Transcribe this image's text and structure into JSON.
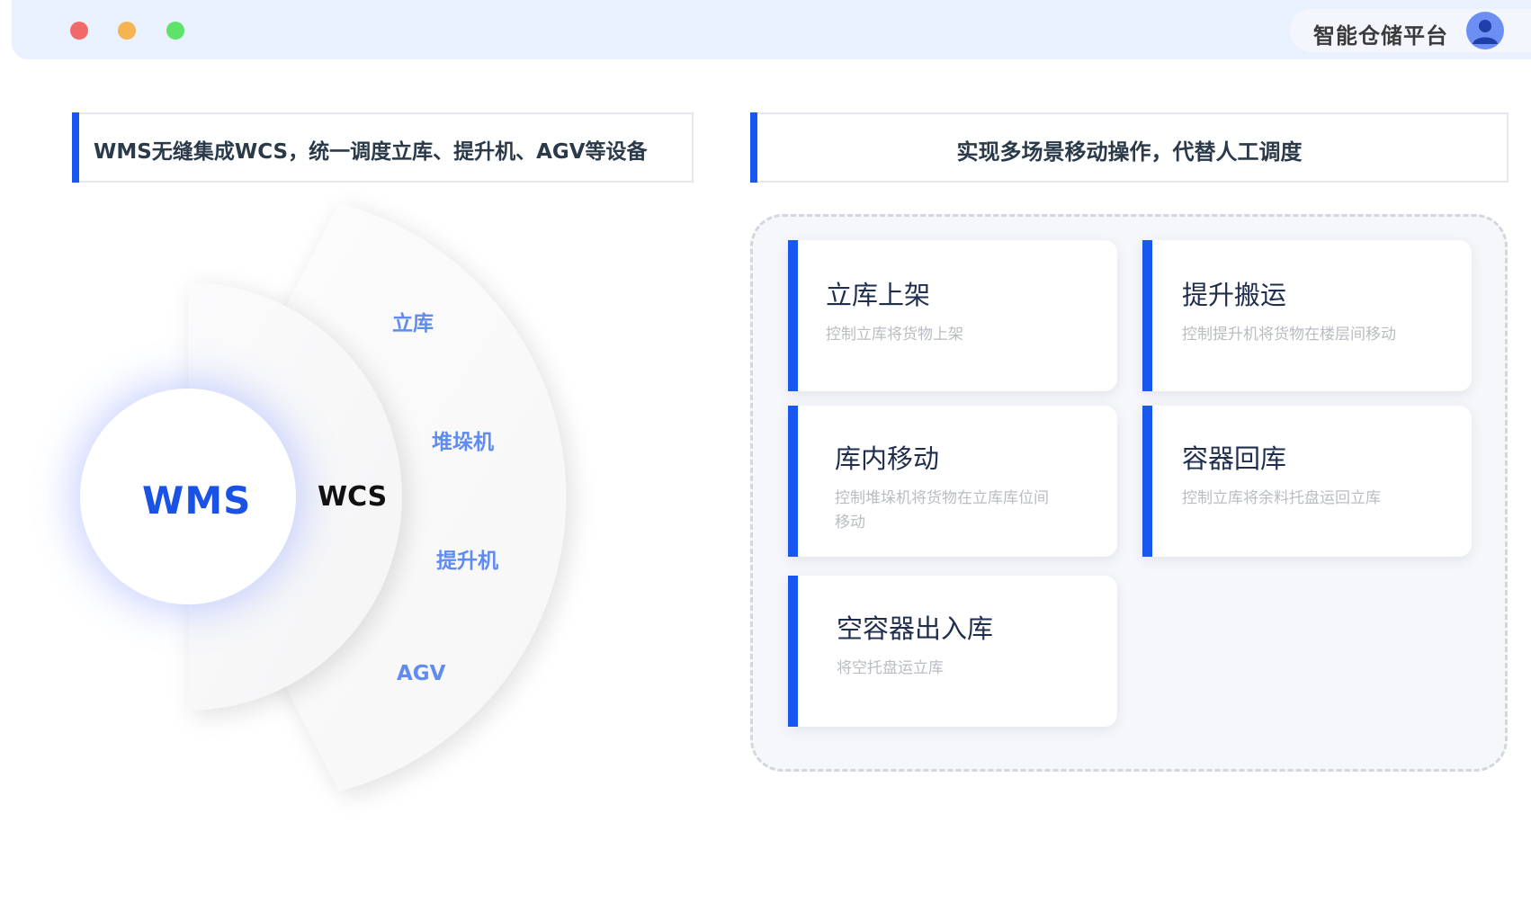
{
  "window": {
    "controls": [
      "close",
      "minimize",
      "maximize"
    ],
    "control_colors": {
      "close": "#f06a6a",
      "minimize": "#f5b352",
      "maximize": "#5de36a"
    },
    "title_bar_color": "#e9f1fe"
  },
  "account": {
    "name": "智能仓储平台",
    "avatar_icon": "user-avatar-icon"
  },
  "left_section": {
    "header": "WMS无缝集成WCS，统一调度立库、提升机、AGV等设备",
    "center_label": "WMS",
    "middle_label": "WCS",
    "devices": [
      "立库",
      "堆垛机",
      "提升机",
      "AGV"
    ]
  },
  "right_section": {
    "header": "实现多场景移动操作，代替人工调度",
    "operations": [
      {
        "title": "立库上架",
        "desc": "控制立库将货物上架"
      },
      {
        "title": "提升搬运",
        "desc": "控制提升机将货物在楼层间移动"
      },
      {
        "title": "库内移动",
        "desc": "控制堆垛机将货物在立库库位间移动"
      },
      {
        "title": "容器回库",
        "desc": "控制立库将余料托盘运回立库"
      },
      {
        "title": "空容器出入库",
        "desc": "将空托盘运立库"
      }
    ]
  },
  "colors": {
    "accent": "#1858f0",
    "wms_text": "#1a52e6",
    "device_text": "#5f8bf2"
  }
}
